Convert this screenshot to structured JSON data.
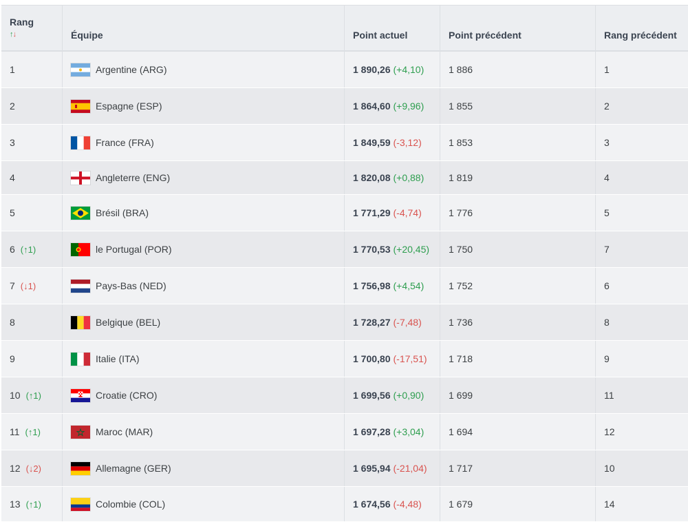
{
  "headers": {
    "rank": "Rang",
    "sort_up": "↑",
    "sort_down": "↓",
    "team": "Équipe",
    "points": "Point actuel",
    "prev_points": "Point précédent",
    "prev_rank": "Rang précédent"
  },
  "rows": [
    {
      "rank": "1",
      "move": "",
      "dir": "",
      "team": "Argentine (ARG)",
      "flag": "argentina-flag-icon",
      "points": "1 890,26",
      "change": "(+4,10)",
      "sign": "pos",
      "prev_points": "1 886",
      "prev_rank": "1"
    },
    {
      "rank": "2",
      "move": "",
      "dir": "",
      "team": "Espagne (ESP)",
      "flag": "spain-flag-icon",
      "points": "1 864,60",
      "change": "(+9,96)",
      "sign": "pos",
      "prev_points": "1 855",
      "prev_rank": "2"
    },
    {
      "rank": "3",
      "move": "",
      "dir": "",
      "team": "France (FRA)",
      "flag": "france-flag-icon",
      "points": "1 849,59",
      "change": "(-3,12)",
      "sign": "neg",
      "prev_points": "1 853",
      "prev_rank": "3"
    },
    {
      "rank": "4",
      "move": "",
      "dir": "",
      "team": "Angleterre (ENG)",
      "flag": "england-flag-icon",
      "points": "1 820,08",
      "change": "(+0,88)",
      "sign": "pos",
      "prev_points": "1 819",
      "prev_rank": "4"
    },
    {
      "rank": "5",
      "move": "",
      "dir": "",
      "team": "Brésil (BRA)",
      "flag": "brazil-flag-icon",
      "points": "1 771,29",
      "change": "(-4,74)",
      "sign": "neg",
      "prev_points": "1 776",
      "prev_rank": "5"
    },
    {
      "rank": "6",
      "move": "(↑1)",
      "dir": "up",
      "team": "le Portugal (POR)",
      "flag": "portugal-flag-icon",
      "points": "1 770,53",
      "change": "(+20,45)",
      "sign": "pos",
      "prev_points": "1 750",
      "prev_rank": "7"
    },
    {
      "rank": "7",
      "move": "(↓1)",
      "dir": "down",
      "team": "Pays-Bas (NED)",
      "flag": "netherlands-flag-icon",
      "points": "1 756,98",
      "change": "(+4,54)",
      "sign": "pos",
      "prev_points": "1 752",
      "prev_rank": "6"
    },
    {
      "rank": "8",
      "move": "",
      "dir": "",
      "team": "Belgique (BEL)",
      "flag": "belgium-flag-icon",
      "points": "1 728,27",
      "change": "(-7,48)",
      "sign": "neg",
      "prev_points": "1 736",
      "prev_rank": "8"
    },
    {
      "rank": "9",
      "move": "",
      "dir": "",
      "team": "Italie (ITA)",
      "flag": "italy-flag-icon",
      "points": "1 700,80",
      "change": "(-17,51)",
      "sign": "neg",
      "prev_points": "1 718",
      "prev_rank": "9"
    },
    {
      "rank": "10",
      "move": "(↑1)",
      "dir": "up",
      "team": "Croatie (CRO)",
      "flag": "croatia-flag-icon",
      "points": "1 699,56",
      "change": "(+0,90)",
      "sign": "pos",
      "prev_points": "1 699",
      "prev_rank": "11"
    },
    {
      "rank": "11",
      "move": "(↑1)",
      "dir": "up",
      "team": "Maroc (MAR)",
      "flag": "morocco-flag-icon",
      "points": "1 697,28",
      "change": "(+3,04)",
      "sign": "pos",
      "prev_points": "1 694",
      "prev_rank": "12"
    },
    {
      "rank": "12",
      "move": "(↓2)",
      "dir": "down",
      "team": "Allemagne (GER)",
      "flag": "germany-flag-icon",
      "points": "1 695,94",
      "change": "(-21,04)",
      "sign": "neg",
      "prev_points": "1 717",
      "prev_rank": "10"
    },
    {
      "rank": "13",
      "move": "(↑1)",
      "dir": "up",
      "team": "Colombie (COL)",
      "flag": "colombia-flag-icon",
      "points": "1 674,56",
      "change": "(-4,48)",
      "sign": "neg",
      "prev_points": "1 679",
      "prev_rank": "14"
    }
  ],
  "colors": {
    "positive": "#2e9e4f",
    "negative": "#d9534f"
  }
}
